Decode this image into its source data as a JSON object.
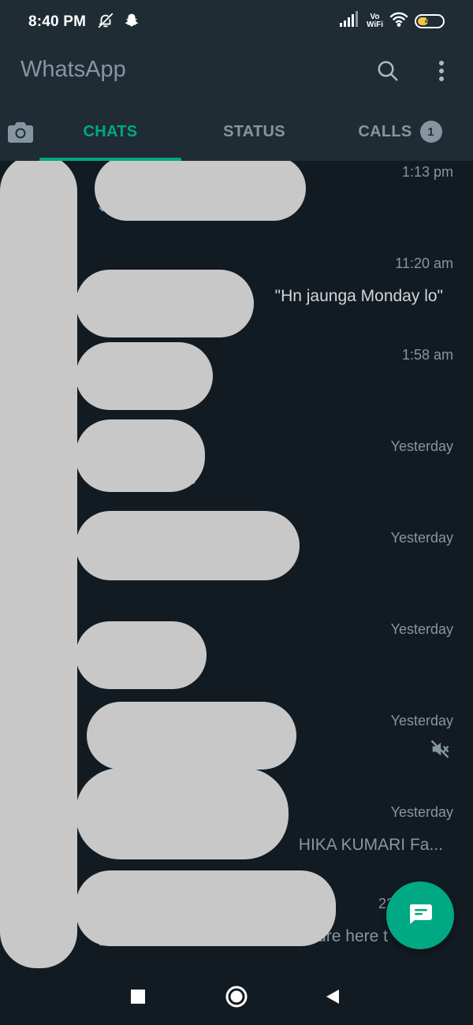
{
  "status_bar": {
    "time": "8:40 PM",
    "vowifi_top": "Vo",
    "vowifi_bottom": "WiFi",
    "battery": "45",
    "battery_level": 0.45
  },
  "app_bar": {
    "title": "WhatsApp",
    "search_icon": "search-icon",
    "menu_icon": "more-vertical-icon"
  },
  "tabs": {
    "camera_icon": "camera-icon",
    "chats": "CHATS",
    "status": "STATUS",
    "calls": "CALLS",
    "calls_badge": "1"
  },
  "chats": [
    {
      "time": "1:13 pm",
      "preview": ""
    },
    {
      "time": "11:20 am",
      "preview": "\"Hn jaunga Monday lo\""
    },
    {
      "time": "1:58 am",
      "preview": ""
    },
    {
      "time": "Yesterday",
      "preview": "s"
    },
    {
      "time": "Yesterday",
      "preview": ""
    },
    {
      "time": "Yesterday",
      "preview": ""
    },
    {
      "time": "Yesterday",
      "preview": "",
      "muted": true
    },
    {
      "time": "Yesterday",
      "preview": "HIKA KUMARI  Fa..."
    },
    {
      "time": "22",
      "preview": "ure here t"
    }
  ],
  "colors": {
    "accent": "#00a884",
    "header": "#1f2c34",
    "background": "#121b22",
    "secondary_text": "#8696a0",
    "redaction": "#c8c8c8"
  },
  "fab": {
    "icon": "new-chat-icon"
  },
  "nav": {
    "recents_icon": "square-icon",
    "home_icon": "circle-icon",
    "back_icon": "triangle-back-icon"
  }
}
